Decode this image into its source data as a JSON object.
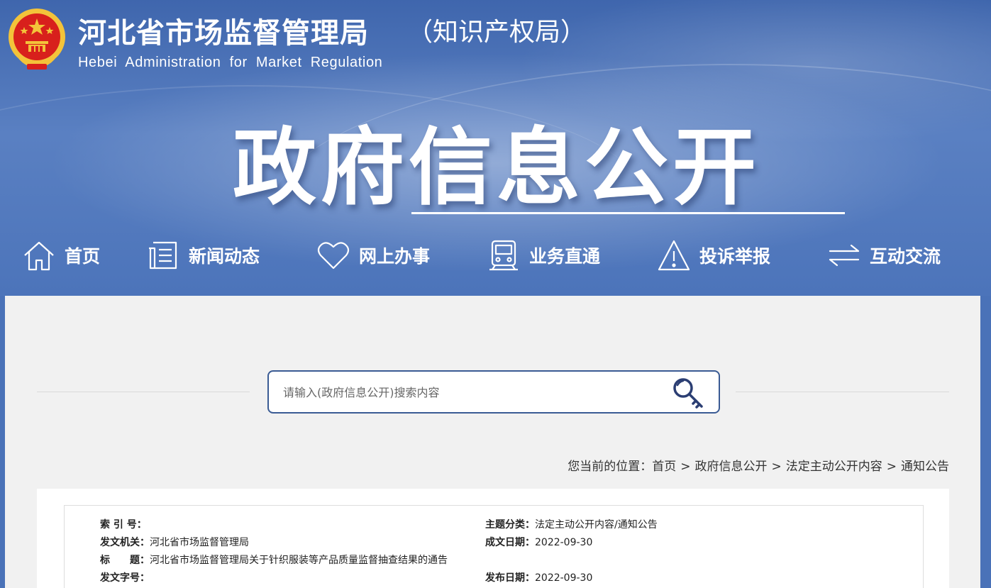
{
  "header": {
    "title": "河北省市场监督管理局",
    "subtitle": "（知识产权局）",
    "english_name": "Hebei Administration for Market Regulation",
    "hero_title": "政府信息公开",
    "emblem_icon": "national-emblem-icon"
  },
  "nav": {
    "items": [
      {
        "label": "首页",
        "icon": "home-icon"
      },
      {
        "label": "新闻动态",
        "icon": "document-icon"
      },
      {
        "label": "网上办事",
        "icon": "heart-icon"
      },
      {
        "label": "业务直通",
        "icon": "train-icon"
      },
      {
        "label": "投诉举报",
        "icon": "warning-icon"
      },
      {
        "label": "互动交流",
        "icon": "exchange-arrows-icon"
      }
    ]
  },
  "search": {
    "placeholder": "请输入(政府信息公开)搜索内容",
    "icon": "search-key-icon"
  },
  "breadcrumb": {
    "prefix": "您当前的位置：",
    "items": [
      "首页",
      "政府信息公开",
      "法定主动公开内容",
      "通知公告"
    ],
    "separator": ">"
  },
  "meta": {
    "index_no_label": "索 引 号：",
    "index_no_value": "",
    "topic_label": "主题分类：",
    "topic_value": "法定主动公开内容/通知公告",
    "issuer_label": "发文机关：",
    "issuer_value": "河北省市场监督管理局",
    "written_date_label": "成文日期：",
    "written_date_value": "2022-09-30",
    "title_label": "标　　题：",
    "title_value": "河北省市场监督管理局关于针织服装等产品质量监督抽查结果的通告",
    "doc_no_label": "发文字号：",
    "doc_no_value": "",
    "publish_date_label": "发布日期：",
    "publish_date_value": "2022-09-30"
  },
  "colors": {
    "banner_blue": "#4a72b8",
    "content_bg": "#f1f1f1",
    "search_border": "#3a5b94",
    "emblem_red": "#d8201c",
    "emblem_gold": "#f3c33a"
  }
}
